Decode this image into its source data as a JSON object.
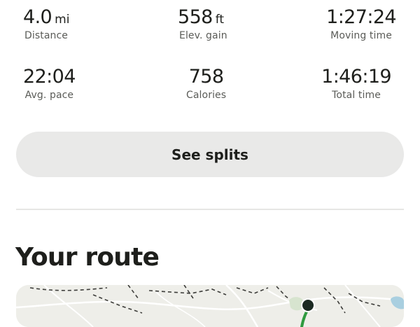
{
  "stats": {
    "distance": {
      "value": "4.0",
      "unit": "mi",
      "label": "Distance"
    },
    "elevation_gain": {
      "value": "558",
      "unit": "ft",
      "label": "Elev. gain"
    },
    "moving_time": {
      "value": "1:27:24",
      "label": "Moving time"
    },
    "avg_pace": {
      "value": "22:04",
      "label": "Avg. pace"
    },
    "calories": {
      "value": "758",
      "label": "Calories"
    },
    "total_time": {
      "value": "1:46:19",
      "label": "Total time"
    }
  },
  "splits_button": {
    "label": "See splits"
  },
  "route": {
    "title": "Your route",
    "map_colors": {
      "land": "#eeeee9",
      "road": "#ffffff",
      "trail": "#3d3d3a",
      "route": "#2f9a3f",
      "marker": "#1c2a22",
      "water": "#a9cfe0"
    }
  }
}
